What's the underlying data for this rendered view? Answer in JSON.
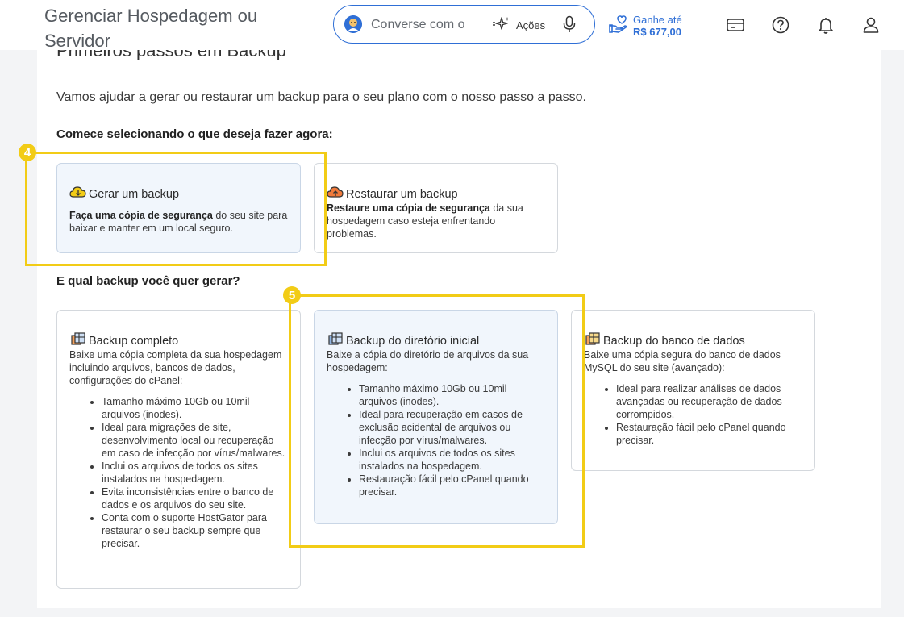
{
  "header": {
    "title": "Gerenciar Hospedagem ou Servidor",
    "search": {
      "placeholder": "Converse com o",
      "value": ""
    },
    "actions_label": "Ações",
    "earn": {
      "line1": "Ganhe até",
      "amount": "R$ 677,00"
    },
    "icons": [
      "card-icon",
      "help-icon",
      "bell-icon",
      "user-icon"
    ]
  },
  "main": {
    "heading": "Primeiros passos em Backup",
    "intro": "Vamos ajudar a gerar ou restaurar um backup para o seu plano com o nosso passo a passo.",
    "step1": {
      "label": "Comece selecionando o que deseja fazer agora:",
      "options": [
        {
          "title": "Gerar um backup",
          "desc_bold": "Faça uma cópia de segurança",
          "desc_rest": " do seu site para baixar e manter em um local seguro.",
          "selected": true
        },
        {
          "title": "Restaurar um backup",
          "desc_bold": "Restaure uma cópia de segurança",
          "desc_rest": " da sua hospedagem caso esteja enfrentando problemas.",
          "selected": false
        }
      ]
    },
    "step2": {
      "label": "E qual backup você quer gerar?",
      "options": [
        {
          "title": "Backup completo",
          "desc": "Baixe uma cópia completa da sua hospedagem incluindo arquivos, bancos de dados, configurações do cPanel:",
          "bullets": [
            "Tamanho máximo 10Gb ou 10mil arquivos (inodes).",
            "Ideal para migrações de site, desenvolvimento local ou recuperação em caso de infecção por vírus/malwares.",
            "Inclui os arquivos de todos os sites instalados na hospedagem.",
            "Evita inconsistências entre o banco de dados e os arquivos do seu site.",
            "Conta com o suporte HostGator para restaurar o seu backup sempre que precisar."
          ],
          "selected": false
        },
        {
          "title": "Backup do diretório inicial",
          "desc": "Baixe a cópia do diretório de arquivos da sua hospedagem:",
          "bullets": [
            "Tamanho máximo 10Gb ou 10mil arquivos (inodes).",
            "Ideal para recuperação em casos de exclusão acidental de arquivos ou infecção por vírus/malwares.",
            "Inclui os arquivos de todos os sites instalados na hospedagem.",
            "Restauração fácil pelo cPanel quando precisar."
          ],
          "selected": true
        },
        {
          "title": "Backup do banco de dados",
          "desc": "Baixe uma cópia segura do banco de dados MySQL do seu site (avançado):",
          "bullets": [
            "Ideal para realizar análises de dados avançadas ou recuperação de dados corrompidos.",
            "Restauração fácil pelo cPanel quando precisar."
          ],
          "selected": false
        }
      ]
    }
  },
  "annotations": [
    {
      "label": "4"
    },
    {
      "label": "5"
    }
  ],
  "colors": {
    "accent": "#2f6fd6",
    "highlight": "#f2cc16",
    "selected_card_bg": "#f1f6fc"
  }
}
